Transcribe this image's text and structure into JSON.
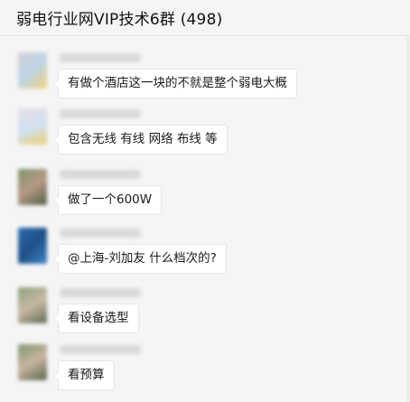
{
  "window": {
    "title": "弱电行业网VIP技术6群 (498)"
  },
  "messages": [
    {
      "text": "有做个酒店这一块的不就是整个弱电大概",
      "avatar_colors": [
        "#d6cfd6",
        "#bcd4e6",
        "#f3d27a"
      ]
    },
    {
      "text": "包含无线 有线 网络  布线  等",
      "avatar_colors": [
        "#e8dde8",
        "#cfe0ef",
        "#f0d070"
      ]
    },
    {
      "text": "做了一个600W",
      "avatar_colors": [
        "#7a9469",
        "#b79a86",
        "#4f5e45"
      ]
    },
    {
      "text": "@上海-刘加友 什么档次的?",
      "avatar_colors": [
        "#2b6cb0",
        "#1f4f86",
        "#3d86c8"
      ]
    },
    {
      "text": "看设备选型",
      "avatar_colors": [
        "#8aa07a",
        "#c9b8a6",
        "#5d6b52"
      ]
    },
    {
      "text": "看预算",
      "avatar_colors": [
        "#7f9670",
        "#c8b5a0",
        "#59664d"
      ]
    }
  ]
}
